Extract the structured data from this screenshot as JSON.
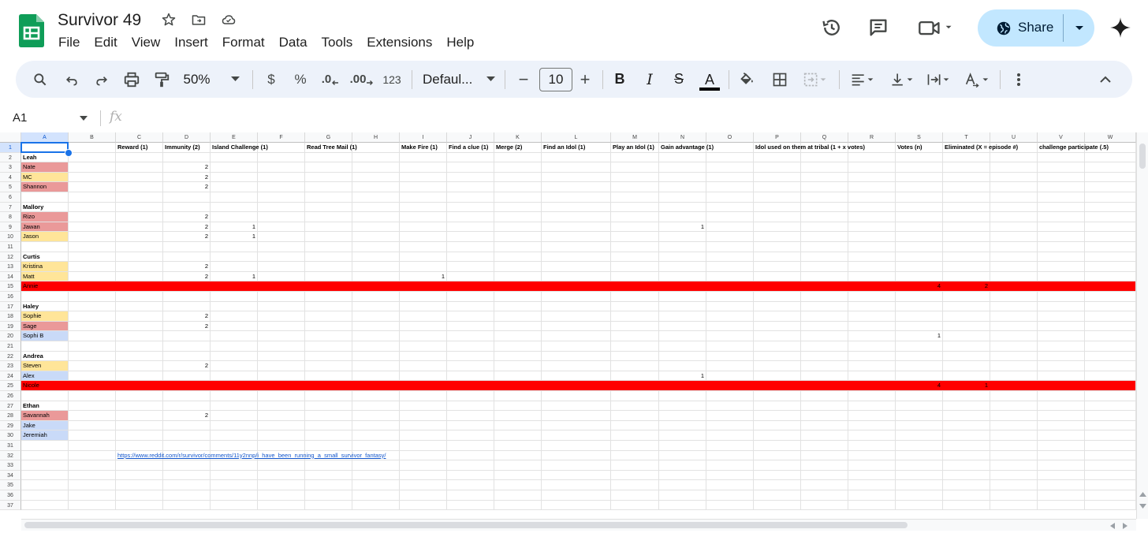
{
  "app": {
    "doc_title": "Survivor 49",
    "menu": [
      "File",
      "Edit",
      "View",
      "Insert",
      "Format",
      "Data",
      "Tools",
      "Extensions",
      "Help"
    ],
    "share_label": "Share",
    "brand_color": "#0f9d58",
    "share_color": "#c2e7ff"
  },
  "toolbar": {
    "zoom": "50%",
    "currency": "$",
    "percent": "%",
    "dec_decrease": ".0",
    "dec_increase": ".00",
    "number_format": "123",
    "font": "Defaul...",
    "minus": "−",
    "font_size": "10",
    "plus": "+",
    "bold": "B",
    "italic": "I",
    "strike": "S",
    "text_color": "A"
  },
  "formula_bar": {
    "name_box": "A1",
    "fx": "fx"
  },
  "columns": [
    "A",
    "B",
    "C",
    "D",
    "E",
    "F",
    "G",
    "H",
    "I",
    "J",
    "K",
    "L",
    "M",
    "N",
    "O",
    "P",
    "Q",
    "R",
    "S",
    "T",
    "U",
    "V",
    "W"
  ],
  "rows": [
    "1",
    "2",
    "3",
    "4",
    "5",
    "6",
    "7",
    "8",
    "9",
    "10",
    "11",
    "12",
    "13",
    "14",
    "15",
    "16",
    "17",
    "18",
    "19",
    "20",
    "21",
    "22",
    "23",
    "24",
    "25",
    "26",
    "27",
    "28",
    "29",
    "30",
    "31",
    "32",
    "33",
    "34",
    "35",
    "36",
    "37"
  ],
  "headers": {
    "reward": "Reward (1)",
    "immunity": "Immunity (2)",
    "island": "Island Challenge (1)",
    "treemail": "Read Tree Mail (1)",
    "fire": "Make Fire (1)",
    "clue": "Find a clue (1)",
    "merge": "Merge (2)",
    "find_idol": "Find an Idol (1)",
    "play_idol": "Play an Idol (1)",
    "advantage": "Gain advantage (1)",
    "idol_used": "Idol used on them at tribal (1 + x votes)",
    "votes": "Votes (n)",
    "eliminated": "Eliminated (X = episode #)",
    "challenge": "challenge participate (.5)"
  },
  "teams": {
    "leah": "Leah",
    "mallory": "Mallory",
    "curtis": "Curtis",
    "haley": "Haley",
    "andrea": "Andrea",
    "ethan": "Ethan"
  },
  "players": {
    "nate": "Nate",
    "mc": "MC",
    "shannon": "Shannon",
    "rizo": "Rizo",
    "jawan": "Jawan",
    "jason": "Jason",
    "kristina": "Kristina",
    "matt": "Matt",
    "annie": "Annie",
    "sophie": "Sophie",
    "sage": "Sage",
    "sophib": "Sophi B",
    "steven": "Steven",
    "alex": "Alex",
    "nicole": "Nicole",
    "savannah": "Savannah",
    "jake": "Jake",
    "jeremiah": "Jeremiah"
  },
  "values": {
    "imm_nate": "2",
    "imm_mc": "2",
    "imm_shannon": "2",
    "imm_rizo": "2",
    "imm_jawan": "2",
    "isl_jawan": "1",
    "adv_jawan": "1",
    "imm_jason": "2",
    "isl_jason": "1",
    "imm_kristina": "2",
    "imm_matt": "2",
    "isl_matt": "1",
    "fire_matt": "1",
    "votes_annie": "4",
    "elim_annie": "2",
    "imm_sophie": "2",
    "imm_sage": "2",
    "votes_sophib": "1",
    "imm_steven": "2",
    "adv_alex": "1",
    "votes_nicole": "4",
    "elim_nicole": "1",
    "imm_savannah": "2"
  },
  "link": "https://www.reddit.com/r/survivor/comments/11y2nnp/i_have_been_running_a_small_survivor_fantasy/",
  "colors": {
    "eliminated_row": "#ff0000",
    "fill_red": "#ea9999",
    "fill_yellow": "#ffe599",
    "fill_blue": "#c9daf8"
  }
}
